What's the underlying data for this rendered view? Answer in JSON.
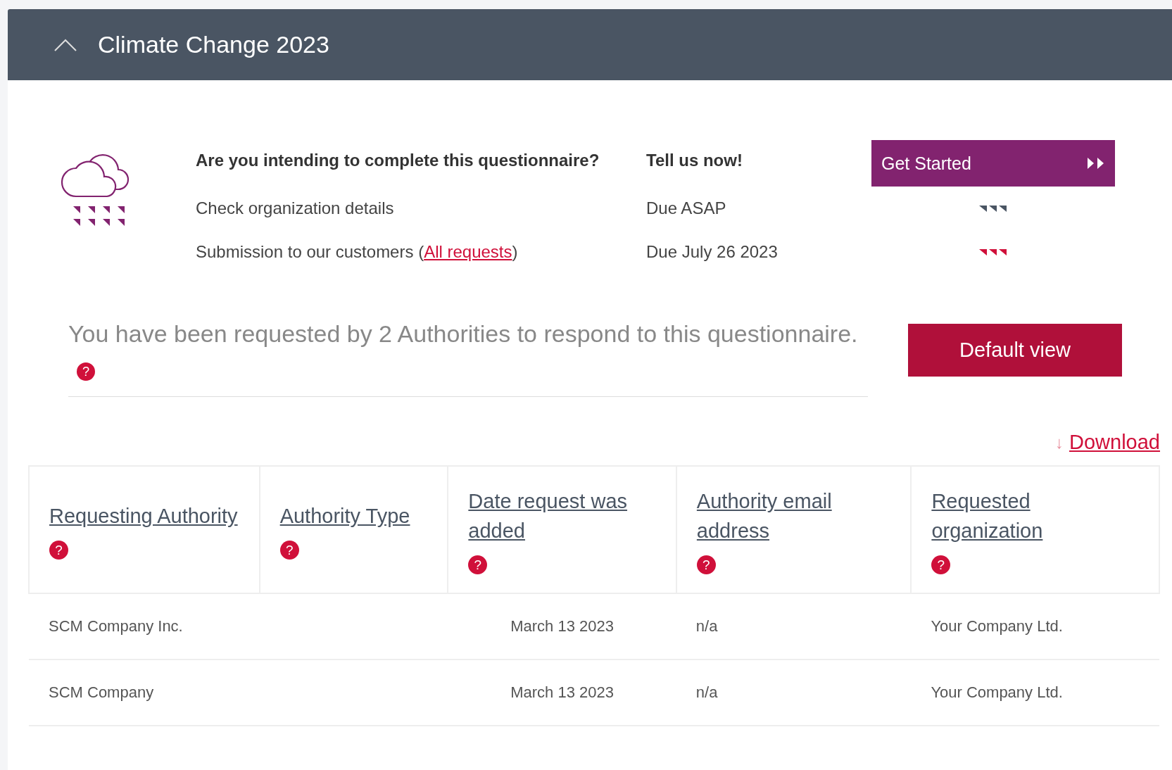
{
  "section": {
    "title": "Climate Change 2023",
    "expanded": true
  },
  "steps": [
    {
      "kind": "question",
      "label": "Are you intending to complete this questionnaire?",
      "status": "Tell us now!",
      "action": "Get Started"
    },
    {
      "kind": "task",
      "label": "Check organization details",
      "status": "Due ASAP",
      "color": "#4a5563"
    },
    {
      "kind": "task",
      "label": "Submission to our customers (",
      "link": "All requests",
      "label_end": ")",
      "status": "Due July 26 2023",
      "color": "#d0103a"
    }
  ],
  "banner": {
    "text": "You have been requested by 2 Authorities to respond to this questionnaire.",
    "help": "?",
    "button": "Default view"
  },
  "download": {
    "icon": "↓",
    "label": "Download"
  },
  "table": {
    "columns": [
      {
        "label": "Requesting Authority",
        "help": "?"
      },
      {
        "label": "Authority Type",
        "help": "?"
      },
      {
        "label": "Date request was added",
        "help": "?"
      },
      {
        "label": "Authority email address",
        "help": "?"
      },
      {
        "label": "Requested organization",
        "help": "?"
      }
    ],
    "rows": [
      [
        "SCM Company Inc.",
        "",
        "March 13 2023",
        "n/a",
        "Your Company Ltd."
      ],
      [
        "SCM Company",
        "",
        "March 13 2023",
        "n/a",
        "Your Company Ltd."
      ]
    ]
  }
}
